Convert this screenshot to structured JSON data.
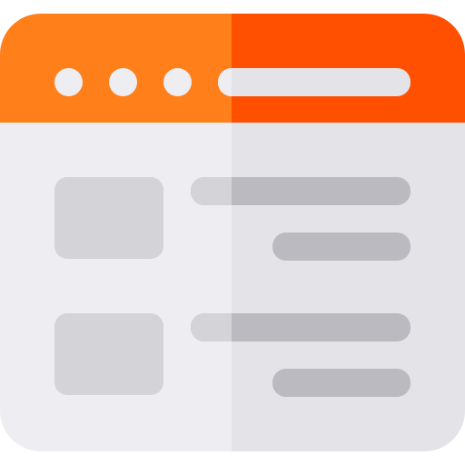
{
  "window": {
    "title_label": "",
    "address_bar": {
      "value": ""
    },
    "controls": [
      {
        "name": "window-dot-1"
      },
      {
        "name": "window-dot-2"
      },
      {
        "name": "window-dot-3"
      }
    ],
    "content": {
      "items": [
        {
          "thumbnail_icon": "image-placeholder",
          "title": "",
          "subtitle": ""
        },
        {
          "thumbnail_icon": "image-placeholder",
          "title": "",
          "subtitle": ""
        }
      ]
    }
  },
  "colors": {
    "titlebar_left": "#FF7F1A",
    "titlebar_right": "#FF4F00",
    "body_left": "#EDEDF2",
    "body_right": "#E3E3E8",
    "dot": "#EDEDF2",
    "addressbar_left": "#EDEDF2",
    "addressbar_right": "#E3E3E8",
    "thumbnail": "#D3D3D8",
    "line_light": "#D3D3D8",
    "line_dark": "#BABAC0"
  }
}
